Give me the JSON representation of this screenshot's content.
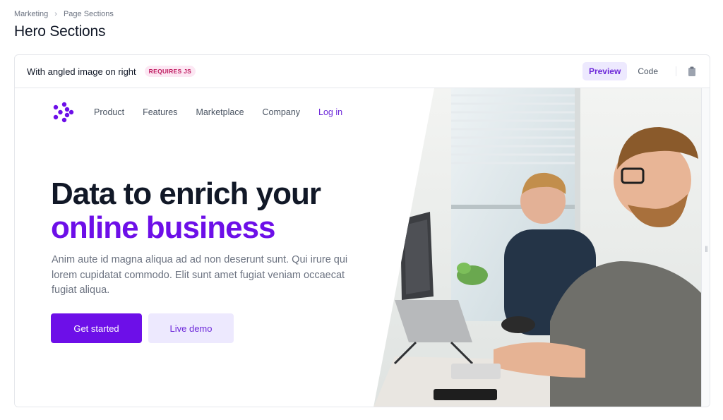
{
  "breadcrumb": {
    "items": [
      "Marketing",
      "Page Sections"
    ],
    "separator": ">"
  },
  "page": {
    "title": "Hero Sections"
  },
  "card": {
    "title": "With angled image on right",
    "badge": "REQUIRES JS",
    "tabs": [
      {
        "label": "Preview",
        "active": true
      },
      {
        "label": "Code",
        "active": false
      }
    ],
    "copy_icon": "clipboard-icon"
  },
  "hero": {
    "nav": {
      "logo_icon": "brand-logo-icon",
      "links": [
        "Product",
        "Features",
        "Marketplace",
        "Company"
      ],
      "login": "Log in"
    },
    "headline_line1": "Data to enrich your",
    "headline_line2": "online business",
    "lead": "Anim aute id magna aliqua ad ad non deserunt sunt. Qui irure qui lorem cupidatat commodo. Elit sunt amet fugiat veniam occaecat fugiat aliqua.",
    "primary_cta": "Get started",
    "secondary_cta": "Live demo",
    "image_subject": "two men working at laptops in a bright office"
  },
  "colors": {
    "brand": "#6d0fe8",
    "brand_light": "#ede9fe",
    "badge_text": "#be185d",
    "badge_bg": "#fce7f3"
  }
}
